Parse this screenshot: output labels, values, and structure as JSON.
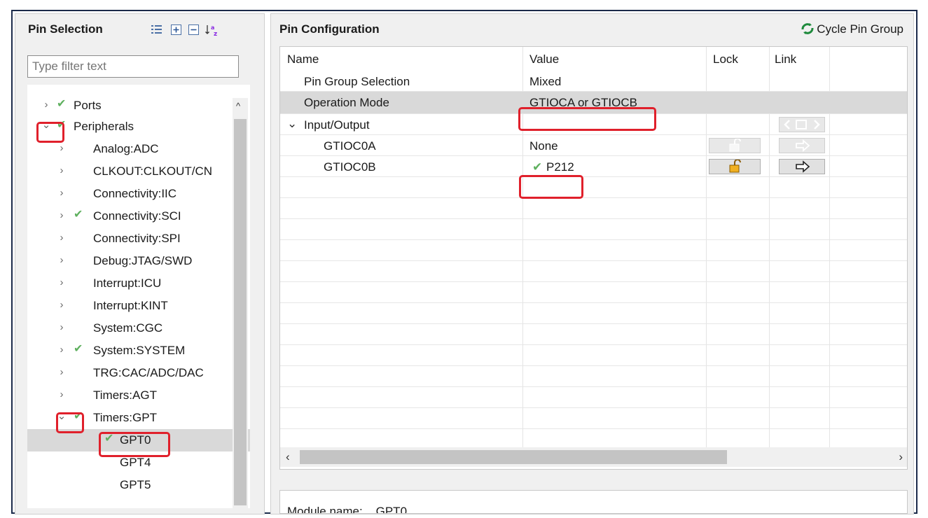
{
  "left_panel": {
    "title": "Pin Selection",
    "filter_placeholder": "Type filter text",
    "toolbar": [
      {
        "icon": "list-icon"
      },
      {
        "icon": "expand-all-icon"
      },
      {
        "icon": "collapse-all-icon"
      },
      {
        "icon": "sort-az-icon"
      }
    ],
    "tree": [
      {
        "label": "Ports",
        "expanded": false,
        "checked": true,
        "level": 0
      },
      {
        "label": "Peripherals",
        "expanded": true,
        "checked": true,
        "level": 0
      },
      {
        "label": "Analog:ADC",
        "expanded": false,
        "checked": false,
        "level": 1
      },
      {
        "label": "CLKOUT:CLKOUT/CN",
        "expanded": false,
        "checked": false,
        "level": 1
      },
      {
        "label": "Connectivity:IIC",
        "expanded": false,
        "checked": false,
        "level": 1
      },
      {
        "label": "Connectivity:SCI",
        "expanded": false,
        "checked": true,
        "level": 1
      },
      {
        "label": "Connectivity:SPI",
        "expanded": false,
        "checked": false,
        "level": 1
      },
      {
        "label": "Debug:JTAG/SWD",
        "expanded": false,
        "checked": false,
        "level": 1
      },
      {
        "label": "Interrupt:ICU",
        "expanded": false,
        "checked": false,
        "level": 1
      },
      {
        "label": "Interrupt:KINT",
        "expanded": false,
        "checked": false,
        "level": 1
      },
      {
        "label": "System:CGC",
        "expanded": false,
        "checked": false,
        "level": 1
      },
      {
        "label": "System:SYSTEM",
        "expanded": false,
        "checked": true,
        "level": 1
      },
      {
        "label": "TRG:CAC/ADC/DAC",
        "expanded": false,
        "checked": false,
        "level": 1
      },
      {
        "label": "Timers:AGT",
        "expanded": false,
        "checked": false,
        "level": 1
      },
      {
        "label": "Timers:GPT",
        "expanded": true,
        "checked": true,
        "level": 1
      },
      {
        "label": "GPT0",
        "checked": true,
        "level": 2,
        "selected": true
      },
      {
        "label": "GPT4",
        "checked": false,
        "level": 2
      },
      {
        "label": "GPT5",
        "checked": false,
        "level": 2
      }
    ]
  },
  "right_panel": {
    "title": "Pin Configuration",
    "cycle_label": "Cycle Pin Group",
    "columns": [
      "Name",
      "Value",
      "Lock",
      "Link"
    ],
    "rows": [
      {
        "name": "Pin Group Selection",
        "value": "Mixed"
      },
      {
        "name": "Operation Mode",
        "value": "GTIOCA or GTIOCB",
        "selected": true
      },
      {
        "name": "Input/Output",
        "value": "",
        "group": true
      },
      {
        "name": "GTIOC0A",
        "value": "None"
      },
      {
        "name": "GTIOC0B",
        "value": "P212",
        "checked": true
      }
    ],
    "bottom_text": "Module name:    GPT0"
  },
  "colors": {
    "highlight": "#e0202b",
    "check": "#5eb05e",
    "selected_row": "#d9d9d9",
    "frame": "#1b2a4a"
  }
}
